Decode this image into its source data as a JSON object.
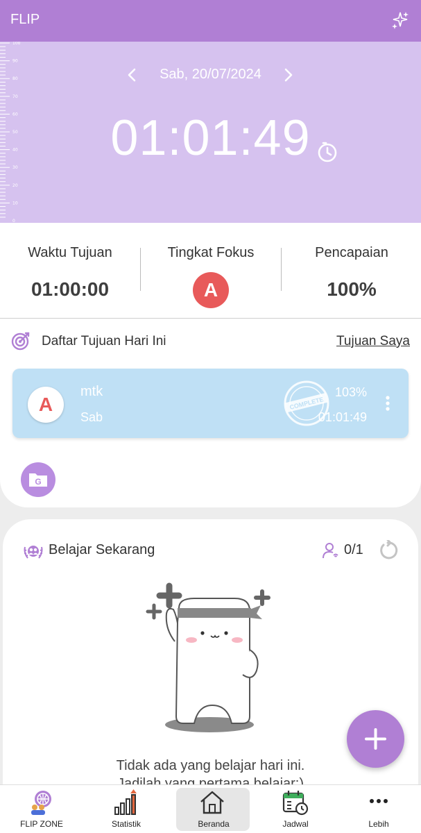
{
  "app": {
    "title": "FLIP"
  },
  "timer": {
    "date": "Sab, 20/07/2024",
    "elapsed": "01:01:49",
    "ruler_labels": [
      "100",
      "90",
      "80",
      "70",
      "60",
      "50",
      "40",
      "30",
      "20",
      "10",
      "0"
    ]
  },
  "stats": {
    "goal_time_label": "Waktu Tujuan",
    "goal_time_value": "01:00:00",
    "focus_label": "Tingkat Fokus",
    "focus_value": "A",
    "achievement_label": "Pencapaian",
    "achievement_value": "100%"
  },
  "goals": {
    "title": "Daftar Tujuan Hari Ini",
    "link": "Tujuan Saya",
    "items": [
      {
        "grade": "A",
        "name": "mtk",
        "day": "Sab",
        "percent": "103%",
        "time": "01:01:49",
        "stamp": "COMPLETE"
      }
    ],
    "group_button_letter": "G"
  },
  "study": {
    "title": "Belajar Sekarang",
    "count": "0/1",
    "empty_line1": "Tidak ada yang belajar hari ini.",
    "empty_line2": "Jadilah yang pertama belajar:)"
  },
  "nav": {
    "items": [
      {
        "label": "FLIP ZONE",
        "icon": "globe-chat-icon"
      },
      {
        "label": "Statistik",
        "icon": "bar-chart-icon"
      },
      {
        "label": "Beranda",
        "icon": "home-icon",
        "active": true
      },
      {
        "label": "Jadwal",
        "icon": "calendar-icon"
      },
      {
        "label": "Lebih",
        "icon": "more-icon"
      }
    ]
  },
  "colors": {
    "primary": "#b07fd4",
    "panel": "#d6c2ef",
    "grade_red": "#e85a5a",
    "goal_blue": "#bfe0f5"
  }
}
